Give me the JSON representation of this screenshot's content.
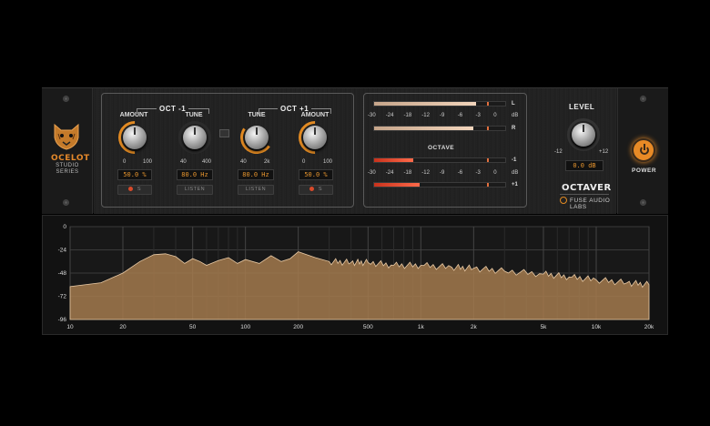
{
  "brand": {
    "name": "OCELOT",
    "line1": "STUDIO",
    "line2": "SERIES"
  },
  "oct_minus": {
    "title": "OCT -1",
    "amount": {
      "label": "AMOUNT",
      "min": "0",
      "max": "100",
      "value": "50.0 %",
      "button_label": "S"
    },
    "tune": {
      "label": "TUNE",
      "min": "40",
      "max": "400",
      "value": "80.0 Hz",
      "button_label": "LISTEN"
    }
  },
  "oct_plus": {
    "title": "OCT +1",
    "tune": {
      "label": "TUNE",
      "min": "40",
      "max": "2k",
      "value": "80.0 Hz",
      "button_label": "LISTEN"
    },
    "amount": {
      "label": "AMOUNT",
      "min": "0",
      "max": "100",
      "value": "50.0 %",
      "button_label": "S"
    }
  },
  "meters": {
    "scale": [
      "-30",
      "-24",
      "-18",
      "-12",
      "-9",
      "-6",
      "-3",
      "0",
      "dB"
    ],
    "input": [
      {
        "channel": "L",
        "level": 0.78
      },
      {
        "channel": "R",
        "level": 0.76
      }
    ],
    "octave_title": "OCTAVE",
    "octave": [
      {
        "channel": "-1",
        "level": 0.3
      },
      {
        "channel": "+1",
        "level": 0.35
      }
    ]
  },
  "level": {
    "title": "LEVEL",
    "min": "-12",
    "max": "+12",
    "value": "0.0 dB"
  },
  "plugin_name": "OCTAVER",
  "maker": "FUSE AUDIO LABS",
  "power_label": "POWER",
  "colors": {
    "accent": "#e88a26",
    "spectrum": "#a37a4e",
    "octave_meter": "#e0452a"
  },
  "analyzer": {
    "y_ticks": [
      "0",
      "-24",
      "-48",
      "-72",
      "-96"
    ],
    "x_ticks": [
      "10",
      "20",
      "50",
      "100",
      "200",
      "500",
      "1k",
      "2k",
      "5k",
      "10k",
      "20k"
    ]
  },
  "chart_data": {
    "type": "area",
    "title": "",
    "xlabel": "",
    "ylabel": "",
    "x_scale": "log",
    "xlim": [
      10,
      20000
    ],
    "ylim": [
      -96,
      0
    ],
    "grid": true,
    "series": [
      {
        "x": [
          10,
          15,
          20,
          25,
          30,
          35,
          40,
          45,
          50,
          55,
          60,
          70,
          80,
          90,
          100,
          120,
          140,
          160,
          180,
          200,
          250,
          300,
          400,
          500,
          700,
          1000,
          1500,
          2000,
          3000,
          5000,
          7000,
          10000,
          15000,
          20000
        ],
        "y": [
          -62,
          -58,
          -48,
          -36,
          -29,
          -28,
          -31,
          -38,
          -33,
          -36,
          -40,
          -35,
          -32,
          -38,
          -34,
          -38,
          -30,
          -36,
          -33,
          -26,
          -32,
          -36,
          -37,
          -37,
          -40,
          -40,
          -42,
          -43,
          -46,
          -49,
          -52,
          -55,
          -58,
          -60
        ]
      }
    ]
  }
}
